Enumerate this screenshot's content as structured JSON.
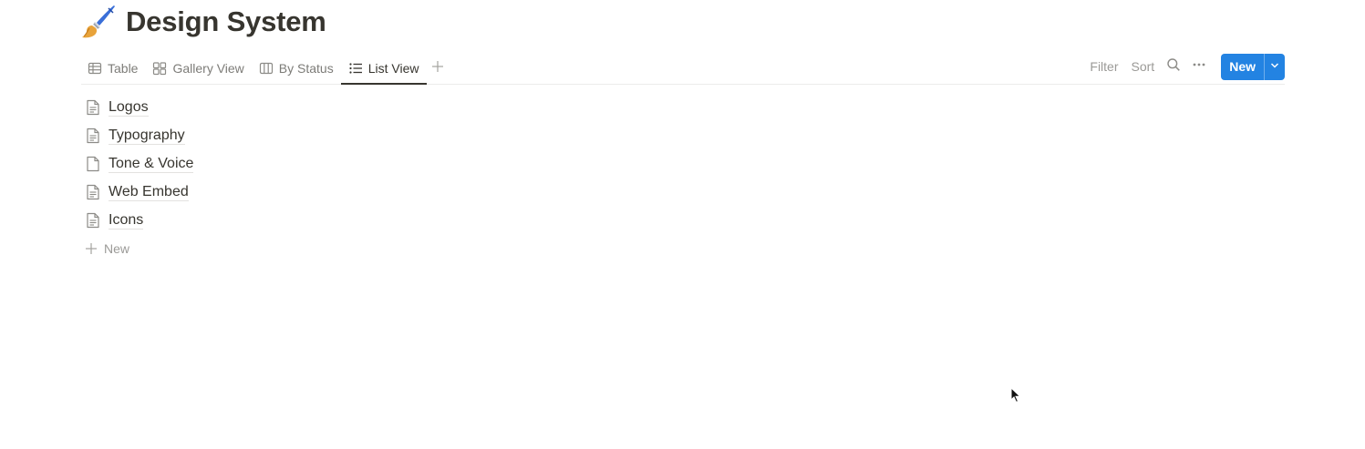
{
  "page": {
    "icon": "paintbrush-emoji",
    "title": "Design System"
  },
  "views": [
    {
      "label": "Table",
      "icon": "table-icon",
      "active": false
    },
    {
      "label": "Gallery View",
      "icon": "gallery-icon",
      "active": false
    },
    {
      "label": "By Status",
      "icon": "board-icon",
      "active": false
    },
    {
      "label": "List View",
      "icon": "list-icon",
      "active": true
    }
  ],
  "toolbar": {
    "filter_label": "Filter",
    "sort_label": "Sort",
    "search_icon": "search-icon",
    "more_icon": "more-horizontal-icon",
    "new_label": "New",
    "new_dropdown_icon": "chevron-down-icon"
  },
  "items": [
    {
      "label": "Logos",
      "icon": "page-text-icon"
    },
    {
      "label": "Typography",
      "icon": "page-text-icon"
    },
    {
      "label": "Tone & Voice",
      "icon": "page-blank-icon"
    },
    {
      "label": "Web Embed",
      "icon": "page-text-icon"
    },
    {
      "label": "Icons",
      "icon": "page-text-icon"
    }
  ],
  "add_row_label": "New",
  "colors": {
    "accent": "#2383e2",
    "text": "#37352f",
    "muted": "#9b9a97"
  }
}
